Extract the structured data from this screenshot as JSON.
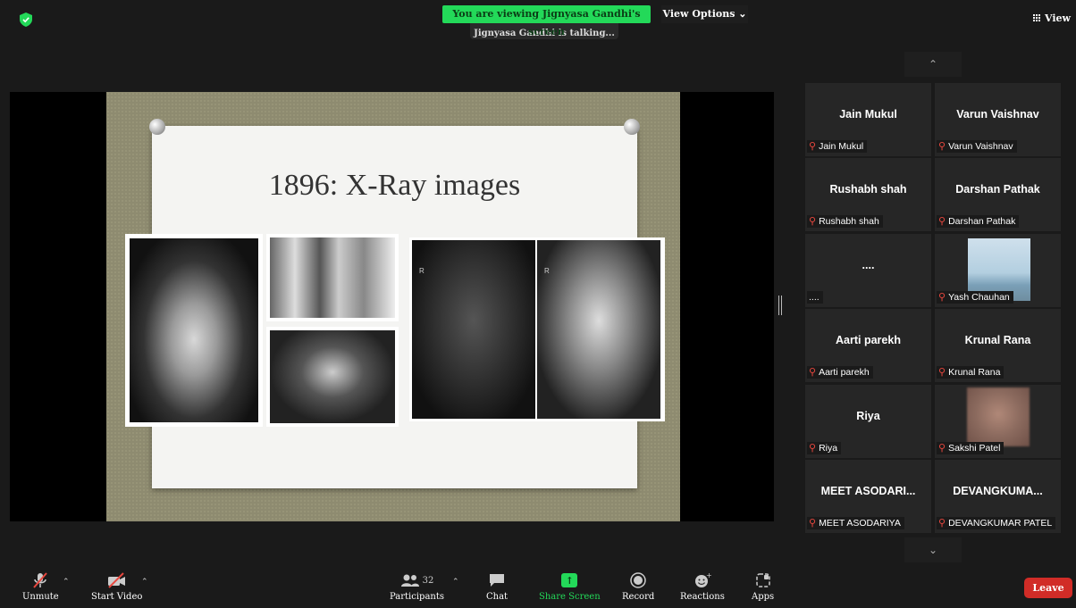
{
  "top_bar": {
    "viewing_banner": "You are viewing Jignyasa Gandhi's screen",
    "talking_indicator": "Jignyasa Gandhi is talking...",
    "view_options_label": "View Options",
    "view_button_label": "View"
  },
  "shared_screen": {
    "slide_title": "1896: X-Ray images",
    "xray_markers": [
      "R",
      "R"
    ]
  },
  "gallery": {
    "participants": [
      {
        "display_name": "Jain Mukul",
        "label": "Jain Mukul",
        "video": "off",
        "muted": true
      },
      {
        "display_name": "Varun Vaishnav",
        "label": "Varun Vaishnav",
        "video": "off",
        "muted": true
      },
      {
        "display_name": "Rushabh shah",
        "label": "Rushabh shah",
        "video": "off",
        "muted": true
      },
      {
        "display_name": "Darshan Pathak",
        "label": "Darshan Pathak",
        "video": "off",
        "muted": true
      },
      {
        "display_name": "....",
        "label": "....",
        "video": "off",
        "muted": false
      },
      {
        "display_name": "",
        "label": "Yash Chauhan",
        "video": "on",
        "muted": true
      },
      {
        "display_name": "Aarti parekh",
        "label": "Aarti parekh",
        "video": "off",
        "muted": true
      },
      {
        "display_name": "Krunal Rana",
        "label": "Krunal Rana",
        "video": "off",
        "muted": true
      },
      {
        "display_name": "Riya",
        "label": "Riya",
        "video": "off",
        "muted": true
      },
      {
        "display_name": "",
        "label": "Sakshi Patel",
        "video": "on",
        "muted": true
      },
      {
        "display_name": "MEET ASODARI...",
        "label": "MEET ASODARIYA",
        "video": "off",
        "muted": true
      },
      {
        "display_name": "DEVANGKUMA...",
        "label": "DEVANGKUMAR PATEL",
        "video": "off",
        "muted": true
      }
    ]
  },
  "toolbar": {
    "unmute_label": "Unmute",
    "start_video_label": "Start Video",
    "participants_label": "Participants",
    "participants_count": "32",
    "chat_label": "Chat",
    "share_screen_label": "Share Screen",
    "record_label": "Record",
    "reactions_label": "Reactions",
    "apps_label": "Apps",
    "leave_label": "Leave"
  },
  "colors": {
    "share_green": "#23d959",
    "leave_red": "#d12c27",
    "mic_off_red": "#e8473e",
    "tile_bg": "#262626"
  }
}
